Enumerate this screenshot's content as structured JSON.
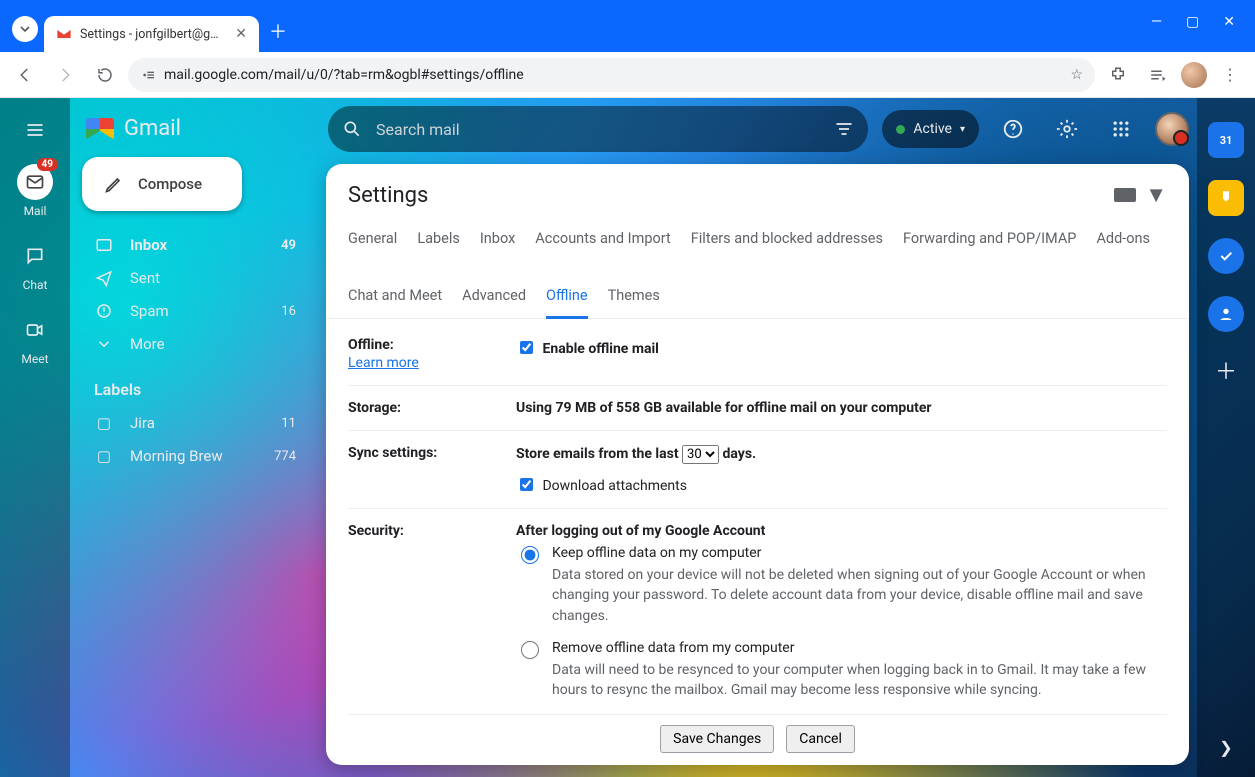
{
  "browser": {
    "tab_title": "Settings - jonfgilbert@gmail.co",
    "url": "mail.google.com/mail/u/0/?tab=rm&ogbl#settings/offline"
  },
  "app_header": {
    "product": "Gmail",
    "search_placeholder": "Search mail",
    "status": "Active"
  },
  "mini_rail": {
    "mail": {
      "label": "Mail",
      "badge": "49"
    },
    "chat": {
      "label": "Chat"
    },
    "meet": {
      "label": "Meet"
    }
  },
  "sidebar": {
    "compose": "Compose",
    "items": [
      {
        "label": "Inbox",
        "count": "49",
        "active": true
      },
      {
        "label": "Sent",
        "count": ""
      },
      {
        "label": "Spam",
        "count": "16"
      },
      {
        "label": "More",
        "count": ""
      }
    ],
    "labels_header": "Labels",
    "labels": [
      {
        "label": "Jira",
        "count": "11"
      },
      {
        "label": "Morning Brew",
        "count": "774"
      }
    ]
  },
  "right_rail": {
    "calendar": "31"
  },
  "settings": {
    "title": "Settings",
    "tabs": [
      "General",
      "Labels",
      "Inbox",
      "Accounts and Import",
      "Filters and blocked addresses",
      "Forwarding and POP/IMAP",
      "Add-ons",
      "Chat and Meet",
      "Advanced",
      "Offline",
      "Themes"
    ],
    "active_tab": "Offline",
    "offline": {
      "label": "Offline:",
      "learn_more": "Learn more",
      "enable_label": "Enable offline mail",
      "enabled": true
    },
    "storage": {
      "label": "Storage:",
      "text": "Using 79 MB of 558 GB available for offline mail on your computer"
    },
    "sync": {
      "label": "Sync settings:",
      "prefix": "Store emails from the last",
      "days_value": "30",
      "suffix": "days.",
      "download_attachments_label": "Download attachments",
      "download_attachments_checked": true
    },
    "security": {
      "label": "Security:",
      "heading": "After logging out of my Google Account",
      "keep": {
        "title": "Keep offline data on my computer",
        "desc": "Data stored on your device will not be deleted when signing out of your Google Account or when changing your password. To delete account data from your device, disable offline mail and save changes."
      },
      "remove": {
        "title": "Remove offline data from my computer",
        "desc": "Data will need to be resynced to your computer when logging back in to Gmail. It may take a few hours to resync the mailbox. Gmail may become less responsive while syncing."
      },
      "selected": "keep"
    },
    "actions": {
      "save": "Save Changes",
      "cancel": "Cancel"
    }
  }
}
